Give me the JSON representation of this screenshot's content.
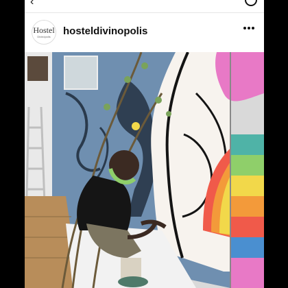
{
  "post": {
    "username": "hosteldivinopolis",
    "avatar_logo_main": "Hostel",
    "avatar_logo_sub": "Divinópolis",
    "more_icon": "more-horizontal-icon"
  },
  "topbar": {
    "back_icon": "chevron-left-icon",
    "notification_icon": "notification-icon"
  },
  "colors": {
    "wall_blue": "#6f8fb0",
    "mural_white": "#f7f3ee",
    "mural_black": "#141414",
    "rainbow": [
      "#f05a4a",
      "#f39a3a",
      "#f2d84a",
      "#8fcf6a",
      "#4fb3a7",
      "#4a8fd0",
      "#e879c6"
    ],
    "floor_wood": "#b88d5a"
  }
}
